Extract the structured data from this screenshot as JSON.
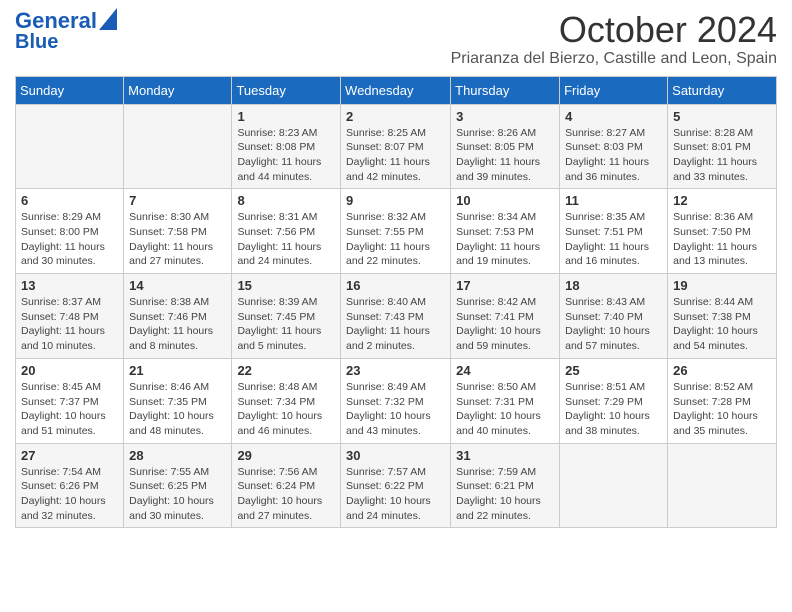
{
  "header": {
    "logo_line1": "General",
    "logo_line2": "Blue",
    "month": "October 2024",
    "location": "Priaranza del Bierzo, Castille and Leon, Spain"
  },
  "days_of_week": [
    "Sunday",
    "Monday",
    "Tuesday",
    "Wednesday",
    "Thursday",
    "Friday",
    "Saturday"
  ],
  "weeks": [
    [
      {
        "day": "",
        "info": ""
      },
      {
        "day": "",
        "info": ""
      },
      {
        "day": "1",
        "info": "Sunrise: 8:23 AM\nSunset: 8:08 PM\nDaylight: 11 hours and 44 minutes."
      },
      {
        "day": "2",
        "info": "Sunrise: 8:25 AM\nSunset: 8:07 PM\nDaylight: 11 hours and 42 minutes."
      },
      {
        "day": "3",
        "info": "Sunrise: 8:26 AM\nSunset: 8:05 PM\nDaylight: 11 hours and 39 minutes."
      },
      {
        "day": "4",
        "info": "Sunrise: 8:27 AM\nSunset: 8:03 PM\nDaylight: 11 hours and 36 minutes."
      },
      {
        "day": "5",
        "info": "Sunrise: 8:28 AM\nSunset: 8:01 PM\nDaylight: 11 hours and 33 minutes."
      }
    ],
    [
      {
        "day": "6",
        "info": "Sunrise: 8:29 AM\nSunset: 8:00 PM\nDaylight: 11 hours and 30 minutes."
      },
      {
        "day": "7",
        "info": "Sunrise: 8:30 AM\nSunset: 7:58 PM\nDaylight: 11 hours and 27 minutes."
      },
      {
        "day": "8",
        "info": "Sunrise: 8:31 AM\nSunset: 7:56 PM\nDaylight: 11 hours and 24 minutes."
      },
      {
        "day": "9",
        "info": "Sunrise: 8:32 AM\nSunset: 7:55 PM\nDaylight: 11 hours and 22 minutes."
      },
      {
        "day": "10",
        "info": "Sunrise: 8:34 AM\nSunset: 7:53 PM\nDaylight: 11 hours and 19 minutes."
      },
      {
        "day": "11",
        "info": "Sunrise: 8:35 AM\nSunset: 7:51 PM\nDaylight: 11 hours and 16 minutes."
      },
      {
        "day": "12",
        "info": "Sunrise: 8:36 AM\nSunset: 7:50 PM\nDaylight: 11 hours and 13 minutes."
      }
    ],
    [
      {
        "day": "13",
        "info": "Sunrise: 8:37 AM\nSunset: 7:48 PM\nDaylight: 11 hours and 10 minutes."
      },
      {
        "day": "14",
        "info": "Sunrise: 8:38 AM\nSunset: 7:46 PM\nDaylight: 11 hours and 8 minutes."
      },
      {
        "day": "15",
        "info": "Sunrise: 8:39 AM\nSunset: 7:45 PM\nDaylight: 11 hours and 5 minutes."
      },
      {
        "day": "16",
        "info": "Sunrise: 8:40 AM\nSunset: 7:43 PM\nDaylight: 11 hours and 2 minutes."
      },
      {
        "day": "17",
        "info": "Sunrise: 8:42 AM\nSunset: 7:41 PM\nDaylight: 10 hours and 59 minutes."
      },
      {
        "day": "18",
        "info": "Sunrise: 8:43 AM\nSunset: 7:40 PM\nDaylight: 10 hours and 57 minutes."
      },
      {
        "day": "19",
        "info": "Sunrise: 8:44 AM\nSunset: 7:38 PM\nDaylight: 10 hours and 54 minutes."
      }
    ],
    [
      {
        "day": "20",
        "info": "Sunrise: 8:45 AM\nSunset: 7:37 PM\nDaylight: 10 hours and 51 minutes."
      },
      {
        "day": "21",
        "info": "Sunrise: 8:46 AM\nSunset: 7:35 PM\nDaylight: 10 hours and 48 minutes."
      },
      {
        "day": "22",
        "info": "Sunrise: 8:48 AM\nSunset: 7:34 PM\nDaylight: 10 hours and 46 minutes."
      },
      {
        "day": "23",
        "info": "Sunrise: 8:49 AM\nSunset: 7:32 PM\nDaylight: 10 hours and 43 minutes."
      },
      {
        "day": "24",
        "info": "Sunrise: 8:50 AM\nSunset: 7:31 PM\nDaylight: 10 hours and 40 minutes."
      },
      {
        "day": "25",
        "info": "Sunrise: 8:51 AM\nSunset: 7:29 PM\nDaylight: 10 hours and 38 minutes."
      },
      {
        "day": "26",
        "info": "Sunrise: 8:52 AM\nSunset: 7:28 PM\nDaylight: 10 hours and 35 minutes."
      }
    ],
    [
      {
        "day": "27",
        "info": "Sunrise: 7:54 AM\nSunset: 6:26 PM\nDaylight: 10 hours and 32 minutes."
      },
      {
        "day": "28",
        "info": "Sunrise: 7:55 AM\nSunset: 6:25 PM\nDaylight: 10 hours and 30 minutes."
      },
      {
        "day": "29",
        "info": "Sunrise: 7:56 AM\nSunset: 6:24 PM\nDaylight: 10 hours and 27 minutes."
      },
      {
        "day": "30",
        "info": "Sunrise: 7:57 AM\nSunset: 6:22 PM\nDaylight: 10 hours and 24 minutes."
      },
      {
        "day": "31",
        "info": "Sunrise: 7:59 AM\nSunset: 6:21 PM\nDaylight: 10 hours and 22 minutes."
      },
      {
        "day": "",
        "info": ""
      },
      {
        "day": "",
        "info": ""
      }
    ]
  ]
}
